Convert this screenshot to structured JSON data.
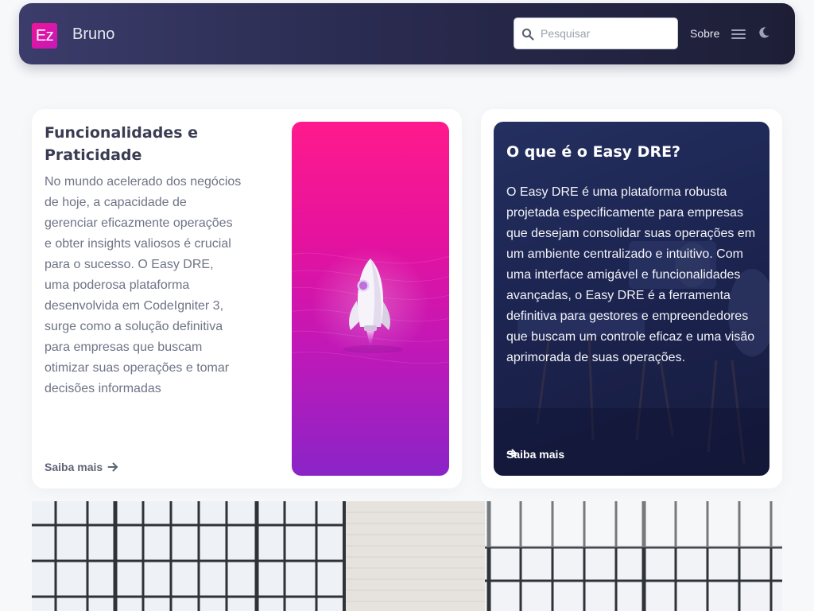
{
  "navbar": {
    "logo_text": "Ez",
    "brand": "Bruno",
    "search_placeholder": "Pesquisar",
    "about_link": "Sobre",
    "icons": [
      "search-icon",
      "hamburger-menu-icon",
      "moon-icon"
    ],
    "gradient_colors": [
      "#3b3c6a",
      "#1d1e36"
    ]
  },
  "card_features": {
    "title": "Funcionalidades e Praticidade",
    "body": "No mundo acelerado dos negócios de hoje, a capacidade de gerenciar eficazmente operações e obter insights valiosos é crucial para o sucesso. O Easy DRE, uma poderosa plataforma desenvolvida em CodeIgniter 3, surge como a solução definitiva para empresas que buscam otimizar suas operações e tomar decisões informadas",
    "link_label": "Saiba mais",
    "illustration": "rocket-illustration",
    "accent_colors": [
      "#ff1a8c",
      "#8a24c7"
    ]
  },
  "card_about": {
    "title": "O que é o Easy DRE?",
    "body": "O Easy DRE é uma plataforma robusta projetada especificamente para empresas que desejam consolidar suas operações em um ambiente centralizado e intuitivo. Com uma interface amigável e funcionalidades avançadas, o Easy DRE é a ferramenta definitiva para gestores e empreendedores que buscam um controle eficaz e uma visão aprimorada de suas operações.",
    "link_label": "Saiba mais",
    "background": "office-meeting-photo"
  },
  "hero": {
    "image": "office-windows-photo"
  }
}
